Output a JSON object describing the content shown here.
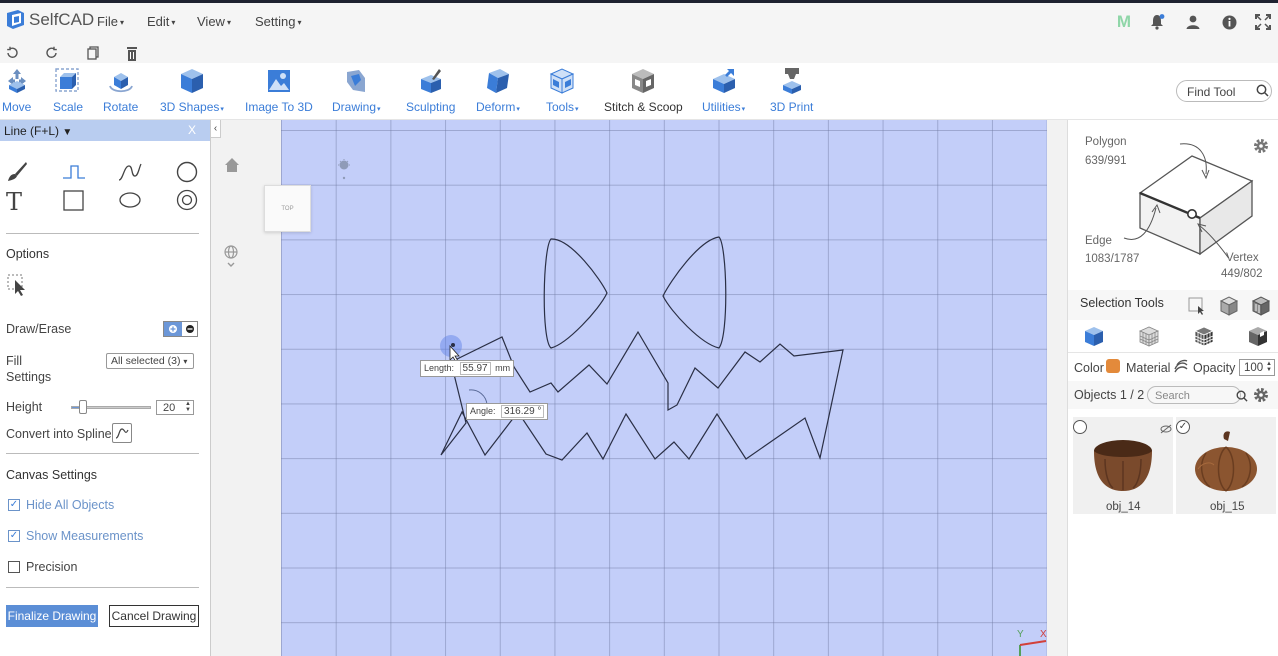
{
  "app": {
    "name": "SelfCAD"
  },
  "menu": [
    {
      "label": "File"
    },
    {
      "label": "Edit"
    },
    {
      "label": "View"
    },
    {
      "label": "Setting"
    }
  ],
  "user_initial": "M",
  "toolbar": {
    "tools": [
      {
        "label": "Move",
        "has_caret": false
      },
      {
        "label": "Scale",
        "has_caret": false
      },
      {
        "label": "Rotate",
        "has_caret": false
      },
      {
        "label": "3D Shapes",
        "has_caret": true
      },
      {
        "label": "Image To 3D",
        "has_caret": false
      },
      {
        "label": "Drawing",
        "has_caret": true
      },
      {
        "label": "Sculpting",
        "has_caret": false
      },
      {
        "label": "Deform",
        "has_caret": true
      },
      {
        "label": "Tools",
        "has_caret": true
      },
      {
        "label": "Stitch & Scoop",
        "has_caret": false
      },
      {
        "label": "Utilities",
        "has_caret": true
      },
      {
        "label": "3D Print",
        "has_caret": false
      }
    ],
    "find_tool_placeholder": "Find Tool"
  },
  "left_panel": {
    "title": "Line (F+L)",
    "close": "X",
    "options_heading": "Options",
    "draw_erase_label": "Draw/Erase",
    "fill_label_1": "Fill",
    "fill_label_2": "Settings",
    "fill_value": "All selected (3)",
    "height_label": "Height",
    "height_value": "20",
    "height_slider_fraction": 0.15,
    "convert_label": "Convert into Spline",
    "canvas_heading": "Canvas Settings",
    "hide_all_objects": "Hide All Objects",
    "show_measurements": "Show Measurements",
    "precision": "Precision",
    "hide_all_checked": true,
    "show_measurements_checked": true,
    "precision_checked": false,
    "finalize_button": "Finalize Drawing",
    "cancel_button": "Cancel Drawing"
  },
  "viewport": {
    "view_cube_label": "TOP",
    "length_label": "Length:",
    "length_value": "55.97",
    "length_unit": "mm",
    "angle_label": "Angle:",
    "angle_value": "316.29 °",
    "axis_y": "Y",
    "axis_x": "X"
  },
  "right_panel": {
    "polygon_label": "Polygon",
    "polygon_count": "639/991",
    "edge_label": "Edge",
    "edge_count": "1083/1787",
    "vertex_label": "Vertex",
    "vertex_count": "449/802",
    "selection_tools": "Selection Tools",
    "color_label": "Color",
    "material_label": "Material",
    "opacity_label": "Opacity",
    "opacity_value": "100",
    "objects_label": "Objects 1 / 2",
    "search_placeholder": "Search",
    "objects": [
      {
        "name": "obj_14",
        "checked": false
      },
      {
        "name": "obj_15",
        "checked": true
      }
    ]
  },
  "colors": {
    "accent": "#3b7dd8",
    "grid": "#c3cef9",
    "panel_header": "#b9cdf0",
    "color_swatch": "#e38a3b",
    "object_brown": "#7a4a2c"
  }
}
